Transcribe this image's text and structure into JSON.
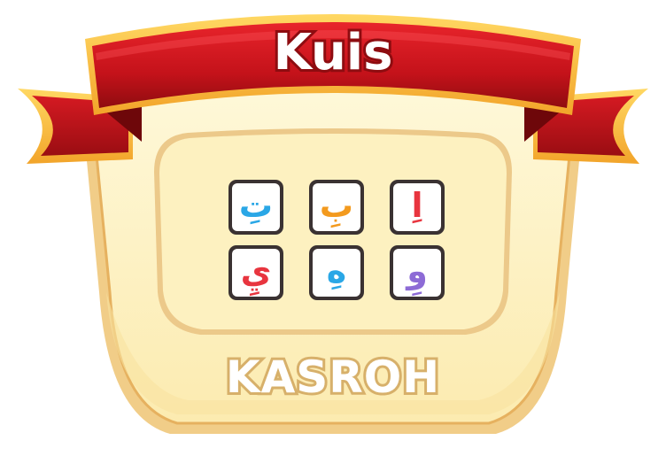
{
  "title": "Kuis",
  "subtitle": "KASROH",
  "letters": [
    {
      "char": "تِ",
      "color": "#2aa7e6"
    },
    {
      "char": "بِ",
      "color": "#f39a1e"
    },
    {
      "char": "اِ",
      "color": "#e8353f"
    },
    {
      "char": "يِ",
      "color": "#e8353f"
    },
    {
      "char": "هِ",
      "color": "#2aa7e6"
    },
    {
      "char": "وِ",
      "color": "#8d6bd6"
    }
  ],
  "colors": {
    "ribbon_red": "#c8141c",
    "ribbon_dark": "#8e0c10",
    "ribbon_gold": "#f6c44b",
    "board_cream": "#fdf3c2",
    "board_border": "#e8b86a",
    "panel_inner": "#fdf1c0",
    "tile_border": "#3a3232"
  }
}
